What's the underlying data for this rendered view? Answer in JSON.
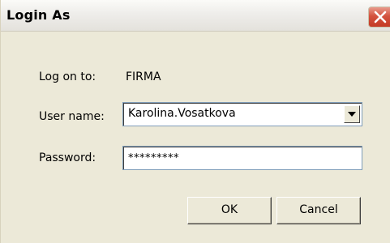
{
  "window": {
    "title": "Login As"
  },
  "form": {
    "log_on_to_label": "Log on to:",
    "log_on_to_value": "FIRMA",
    "user_name_label": "User name:",
    "user_name_value": "Karolina.Vosatkova",
    "password_label": "Password:",
    "password_value": "*********"
  },
  "buttons": {
    "ok_label": "OK",
    "cancel_label": "Cancel"
  },
  "icons": {
    "close": "close-icon",
    "dropdown": "chevron-down-icon"
  },
  "colors": {
    "dialog_background": "#ece9d8",
    "close_button": "#d4533f",
    "field_border": "#7f9db9"
  }
}
